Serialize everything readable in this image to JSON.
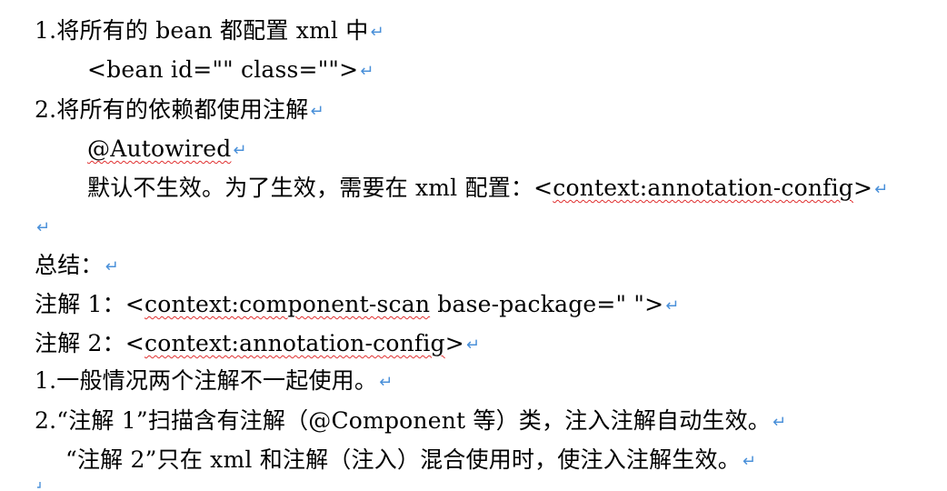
{
  "paragraph_mark": "↵",
  "lines": [
    {
      "text": "1.将所有的 bean 都配置 xml 中"
    },
    {
      "text": "<bean id=\"\" class=\"\">"
    },
    {
      "text": "2.将所有的依赖都使用注解"
    },
    {
      "text": "@Autowired"
    },
    {
      "prefix": "默认不生效。为了生效，需要在 xml 配置：<",
      "link": "context:annotation-config",
      "suffix": ">"
    },
    {
      "text": ""
    },
    {
      "text": "总结："
    },
    {
      "prefix": "注解 1：<",
      "link": "context:component-scan",
      "suffix": " base-package=\" \">"
    },
    {
      "prefix": "注解 2：<",
      "link": "context:annotation-config",
      "suffix": ">"
    },
    {
      "text": "1.一般情况两个注解不一起使用。"
    },
    {
      "text": "2.“注解 1”扫描含有注解（@Component  等）类，注入注解自动生效。"
    },
    {
      "text": "“注解 2”只在 xml 和注解（注入）混合使用时，使注入注解生效。"
    }
  ]
}
